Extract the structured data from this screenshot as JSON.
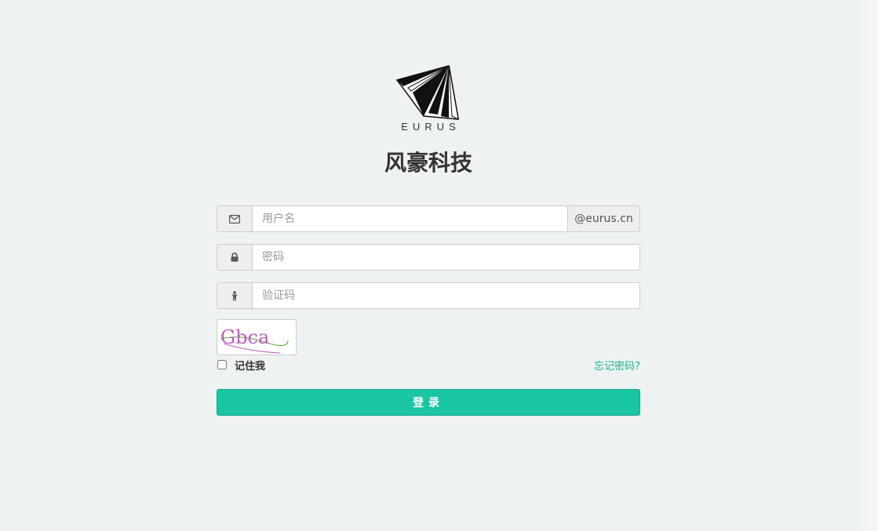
{
  "brand": {
    "logo_text": "EURUS",
    "company_name": "风豪科技"
  },
  "form": {
    "username": {
      "placeholder": "用户名",
      "value": "",
      "icon": "envelope-icon",
      "suffix": "@eurus.cn"
    },
    "password": {
      "placeholder": "密码",
      "value": "",
      "icon": "lock-icon"
    },
    "captcha": {
      "placeholder": "验证码",
      "value": "",
      "icon": "person-icon",
      "image_text": "Gbca"
    },
    "remember_label": "记住我",
    "remember_checked": false,
    "forgot_label": "忘记密码?",
    "login_label": "登录"
  },
  "colors": {
    "accent": "#1ac5a3",
    "link": "#1ab394",
    "background": "#eef2f2"
  }
}
